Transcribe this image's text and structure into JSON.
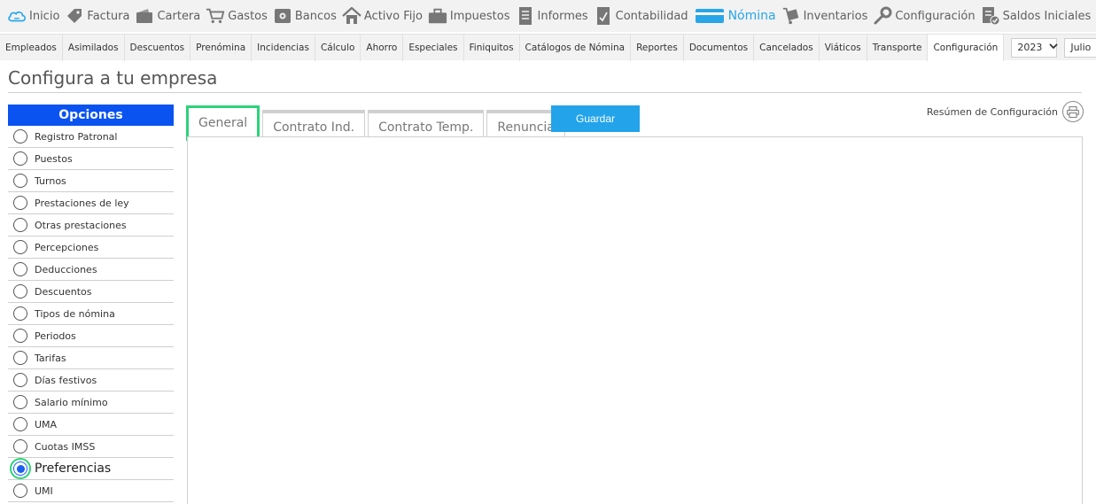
{
  "topnav": [
    {
      "label": "Inicio",
      "icon": "cloud-icon"
    },
    {
      "label": "Factura",
      "icon": "tag-icon"
    },
    {
      "label": "Cartera",
      "icon": "wallet-icon"
    },
    {
      "label": "Gastos",
      "icon": "cart-icon"
    },
    {
      "label": "Bancos",
      "icon": "safe-icon"
    },
    {
      "label": "Activo Fijo",
      "icon": "house-icon"
    },
    {
      "label": "Impuestos",
      "icon": "briefcase-icon"
    },
    {
      "label": "Informes",
      "icon": "document-icon"
    },
    {
      "label": "Contabilidad",
      "icon": "ledger-icon"
    },
    {
      "label": "Nómina",
      "icon": "card-icon",
      "active": true
    },
    {
      "label": "Inventarios",
      "icon": "dolly-icon"
    },
    {
      "label": "Configuración",
      "icon": "wrench-icon"
    },
    {
      "label": "Saldos Iniciales",
      "icon": "checklist-icon"
    }
  ],
  "subnav": {
    "tabs": [
      "Empleados",
      "Asimilados",
      "Descuentos",
      "Prenómina",
      "Incidencias",
      "Cálculo",
      "Ahorro",
      "Especiales",
      "Finiquitos",
      "Catálogos de Nómina",
      "Reportes",
      "Documentos",
      "Cancelados",
      "Viáticos",
      "Transporte",
      "Configuración"
    ],
    "active_tab": "Configuración",
    "year": "2023",
    "month": "Julio"
  },
  "page": {
    "title": "Configura a tu empresa"
  },
  "sidebar": {
    "header": "Opciones",
    "items": [
      "Registro Patronal",
      "Puestos",
      "Turnos",
      "Prestaciones de ley",
      "Otras prestaciones",
      "Percepciones",
      "Deducciones",
      "Descuentos",
      "Tipos de nómina",
      "Periodos",
      "Tarifas",
      "Días festivos",
      "Salario mínimo",
      "UMA",
      "Cuotas IMSS",
      "Preferencias",
      "UMI"
    ],
    "selected": "Preferencias"
  },
  "content": {
    "tabs": [
      "General",
      "Contrato Ind.",
      "Contrato Temp.",
      "Renuncia"
    ],
    "active_tab": "General",
    "save_label": "Guardar",
    "summary_label": "Resúmen de Configuración"
  },
  "colors": {
    "accent": "#22a3ea",
    "sidebar_header": "#0a53f0",
    "highlight": "#2ed27a",
    "nav_active": "#29a6e8"
  }
}
